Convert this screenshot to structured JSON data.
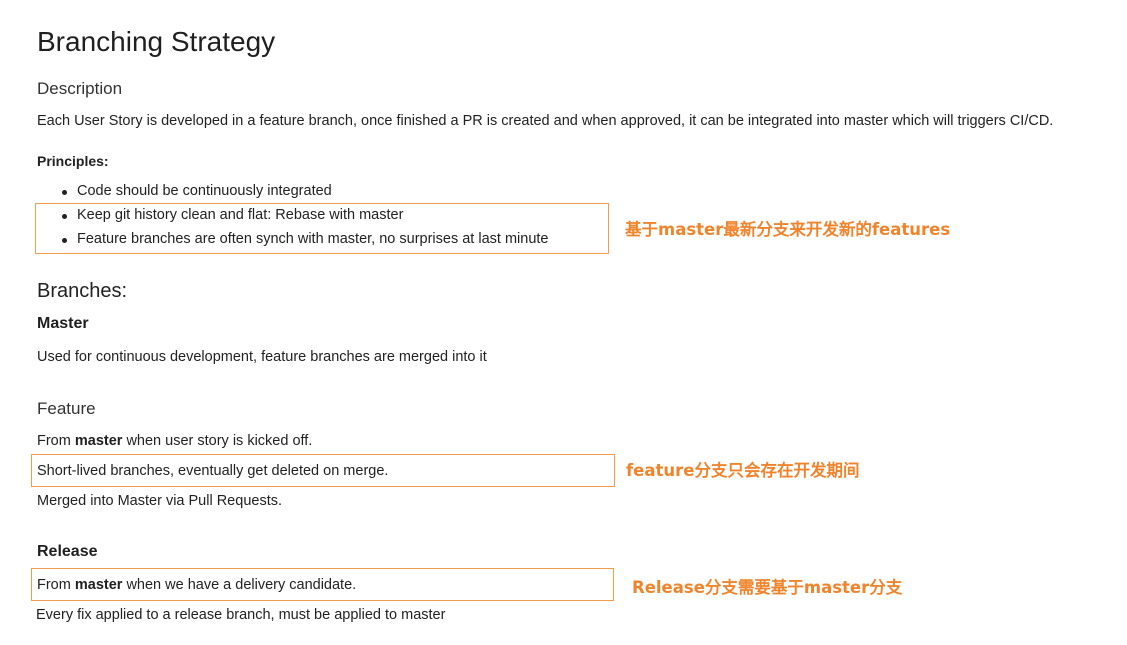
{
  "title": "Branching Strategy",
  "description": {
    "heading": "Description",
    "text": "Each User Story is developed in a feature branch, once finished a PR is created and when approved, it can be integrated into master which will triggers CI/CD."
  },
  "principles": {
    "label": "Principles:",
    "items": [
      "Code should be continuously integrated",
      "Keep git history clean and flat: Rebase with master",
      "Feature branches are often synch with master, no surprises at last minute"
    ],
    "annotation": "基于master最新分支来开发新的features"
  },
  "branches": {
    "heading": "Branches:",
    "master": {
      "heading": "Master",
      "text": "Used for continuous development, feature branches are merged into it"
    },
    "feature": {
      "heading": "Feature",
      "line1_prefix": "From ",
      "line1_bold": "master",
      "line1_suffix": " when user story is kicked off.",
      "line2": "Short-lived branches, eventually get deleted on merge.",
      "line3": "Merged into Master via Pull Requests.",
      "annotation": "feature分支只会存在开发期间"
    },
    "release": {
      "heading": "Release",
      "line1_prefix": "From ",
      "line1_bold": "master",
      "line1_suffix": " when we have a delivery candidate.",
      "line2": "Every fix applied to a release branch, must be applied to master",
      "annotation": "Release分支需要基于master分支"
    }
  },
  "colors": {
    "annotation": "#f0842c",
    "highlight_border": "#f39c4b",
    "text": "#222222"
  }
}
